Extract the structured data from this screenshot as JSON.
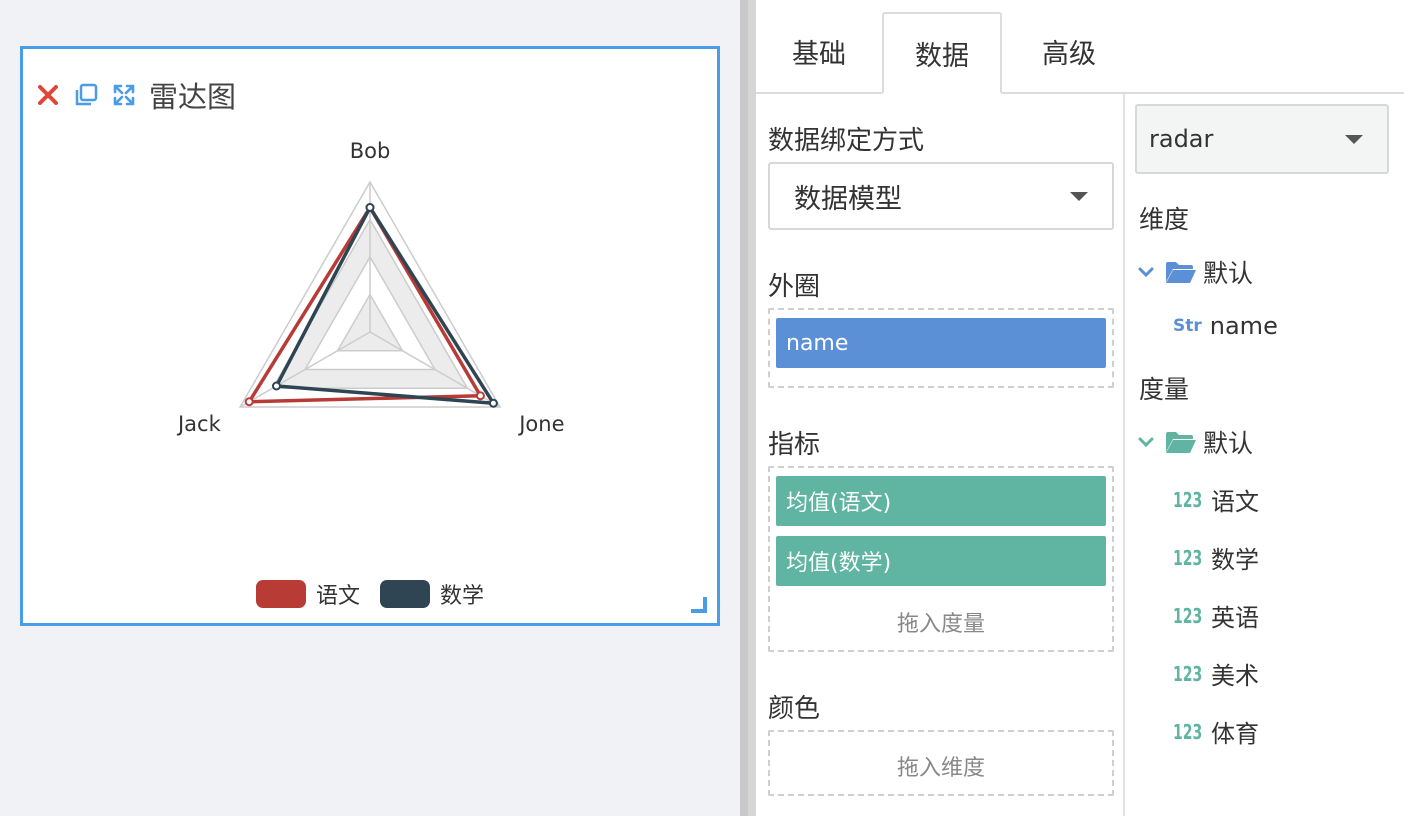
{
  "widget": {
    "title": "雷达图",
    "icons": [
      "close-icon",
      "copy-icon",
      "expand-icon"
    ],
    "colors": {
      "border": "#4a9be8",
      "close": "#e0453a",
      "copy": "#4a9be8",
      "expand": "#4a9be8"
    }
  },
  "chart_data": {
    "type": "radar",
    "indicators": [
      "Bob",
      "Jone",
      "Jack"
    ],
    "series": [
      {
        "name": "语文",
        "color": "#b83b36",
        "values": [
          0.83,
          0.85,
          0.93
        ]
      },
      {
        "name": "数学",
        "color": "#2f4554",
        "values": [
          0.83,
          0.95,
          0.72
        ]
      }
    ],
    "max": 1,
    "split_number": 4,
    "legend_position": "bottom-center"
  },
  "tabs": [
    {
      "label": "基础",
      "active": false
    },
    {
      "label": "数据",
      "active": true
    },
    {
      "label": "高级",
      "active": false
    }
  ],
  "config": {
    "binding_label": "数据绑定方式",
    "binding_value": "数据模型",
    "outer_label": "外圈",
    "outer_chips": [
      "name"
    ],
    "metric_label": "指标",
    "metric_chips": [
      "均值(语文)",
      "均值(数学)"
    ],
    "metric_hint": "拖入度量",
    "color_label": "颜色",
    "color_hint": "拖入维度"
  },
  "fields": {
    "chart_type": "radar",
    "dimension_label": "维度",
    "dimension_folder": "默认",
    "dimension_items": [
      {
        "type": "Str",
        "name": "name"
      }
    ],
    "measure_label": "度量",
    "measure_folder": "默认",
    "measure_items": [
      {
        "type": "123",
        "name": "语文"
      },
      {
        "type": "123",
        "name": "数学"
      },
      {
        "type": "123",
        "name": "英语"
      },
      {
        "type": "123",
        "name": "美术"
      },
      {
        "type": "123",
        "name": "体育"
      }
    ],
    "colors": {
      "dimension": "#5b8fd6",
      "measure": "#5fb5a2"
    }
  }
}
